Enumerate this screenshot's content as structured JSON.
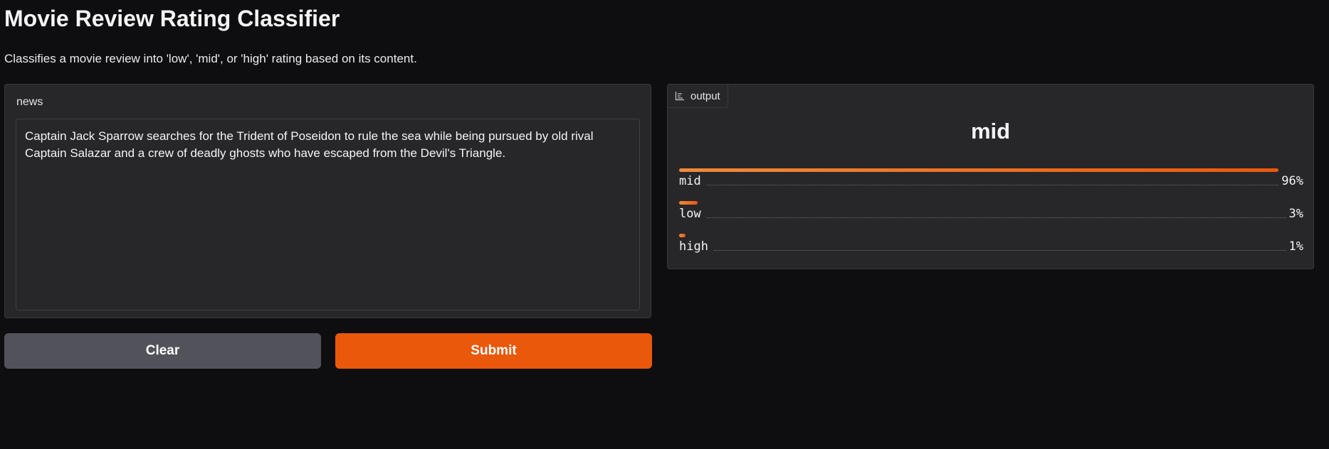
{
  "header": {
    "title": "Movie Review Rating Classifier",
    "description": "Classifies a movie review into 'low', 'mid', or 'high' rating based on its content."
  },
  "input": {
    "label": "news",
    "value": "Captain Jack Sparrow searches for the Trident of Poseidon to rule the sea while being pursued by old rival Captain Salazar and a crew of deadly ghosts who have escaped from the Devil's Triangle."
  },
  "buttons": {
    "clear": "Clear",
    "submit": "Submit"
  },
  "output": {
    "tab_label": "output",
    "tab_icon": "bar-chart-icon",
    "predicted_label": "mid",
    "confidences": [
      {
        "label": "mid",
        "percent_text": "96%",
        "fraction": 0.96
      },
      {
        "label": "low",
        "percent_text": "3%",
        "fraction": 0.03
      },
      {
        "label": "high",
        "percent_text": "1%",
        "fraction": 0.01
      }
    ]
  },
  "colors": {
    "background": "#0e0e10",
    "panel": "#27272a",
    "accent": "#ea580c",
    "secondary_button": "#52525b"
  }
}
